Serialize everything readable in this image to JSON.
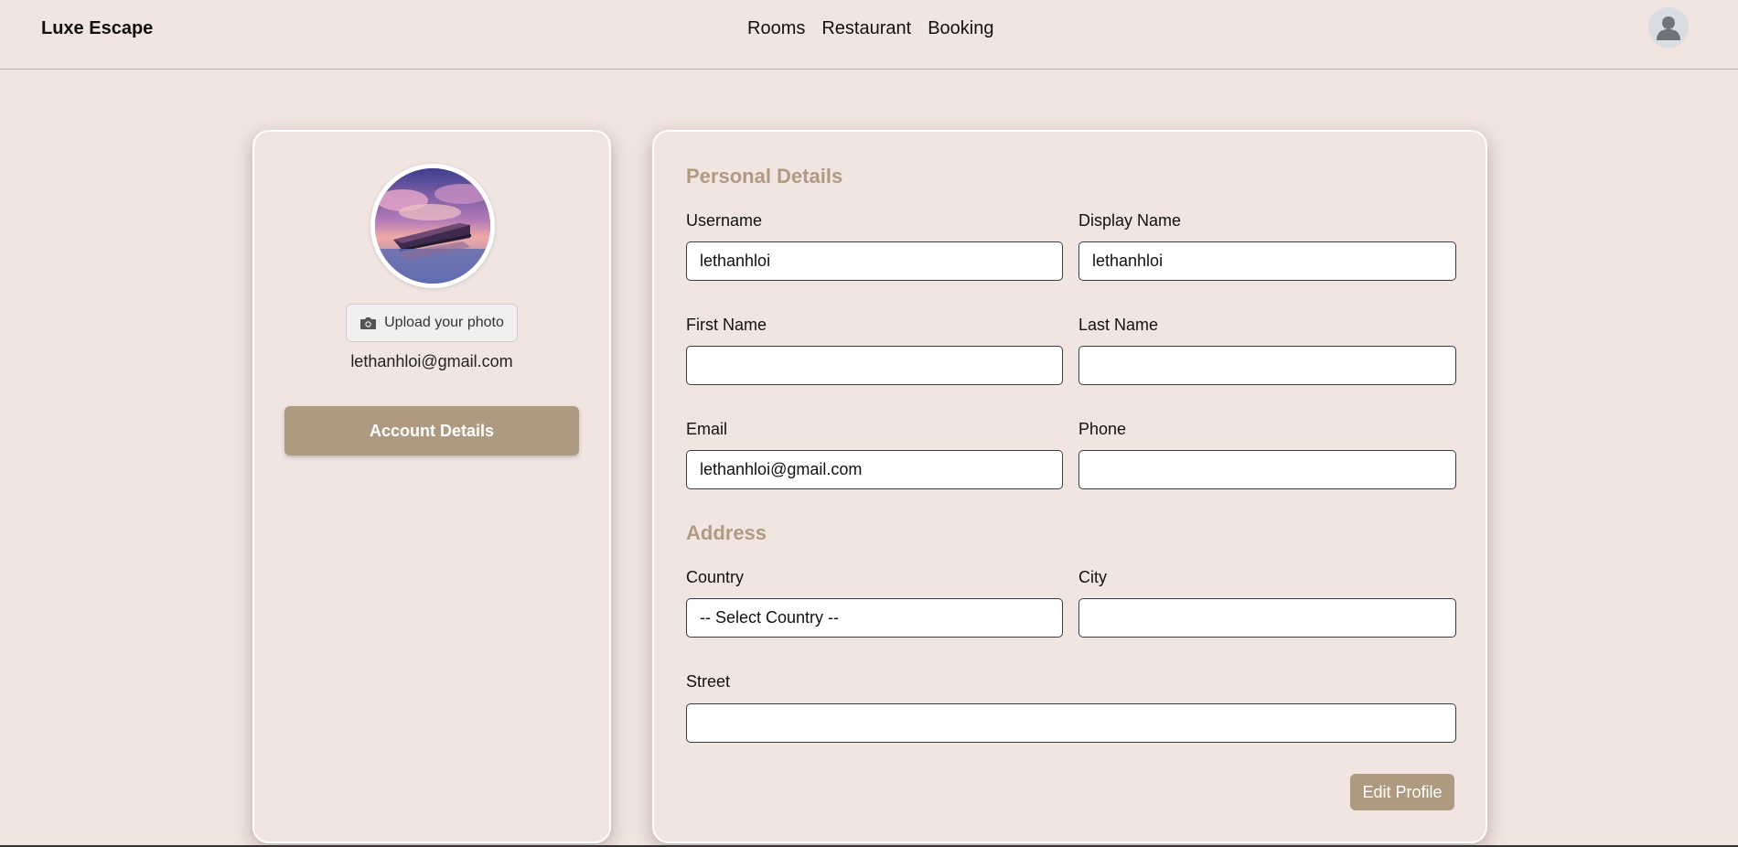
{
  "header": {
    "brand": "Luxe Escape",
    "nav": [
      "Rooms",
      "Restaurant",
      "Booking"
    ],
    "user_icon": "user-avatar-icon"
  },
  "sidebar": {
    "upload_label": "Upload your photo",
    "upload_icon": "camera-icon",
    "email": "lethanhloi@gmail.com",
    "account_button": "Account Details"
  },
  "personal": {
    "title": "Personal Details",
    "username": {
      "label": "Username",
      "value": "lethanhloi"
    },
    "display_name": {
      "label": "Display Name",
      "value": "lethanhloi"
    },
    "first_name": {
      "label": "First Name",
      "value": ""
    },
    "last_name": {
      "label": "Last Name",
      "value": ""
    },
    "email": {
      "label": "Email",
      "value": "lethanhloi@gmail.com"
    },
    "phone": {
      "label": "Phone",
      "value": ""
    }
  },
  "address": {
    "title": "Address",
    "country": {
      "label": "Country",
      "value": "-- Select Country --"
    },
    "city": {
      "label": "City",
      "value": ""
    },
    "street": {
      "label": "Street",
      "value": ""
    }
  },
  "actions": {
    "edit_profile": "Edit Profile"
  },
  "colors": {
    "background": "#f1e5e2",
    "accent": "#ad9a80",
    "section_title": "#b09a82"
  }
}
